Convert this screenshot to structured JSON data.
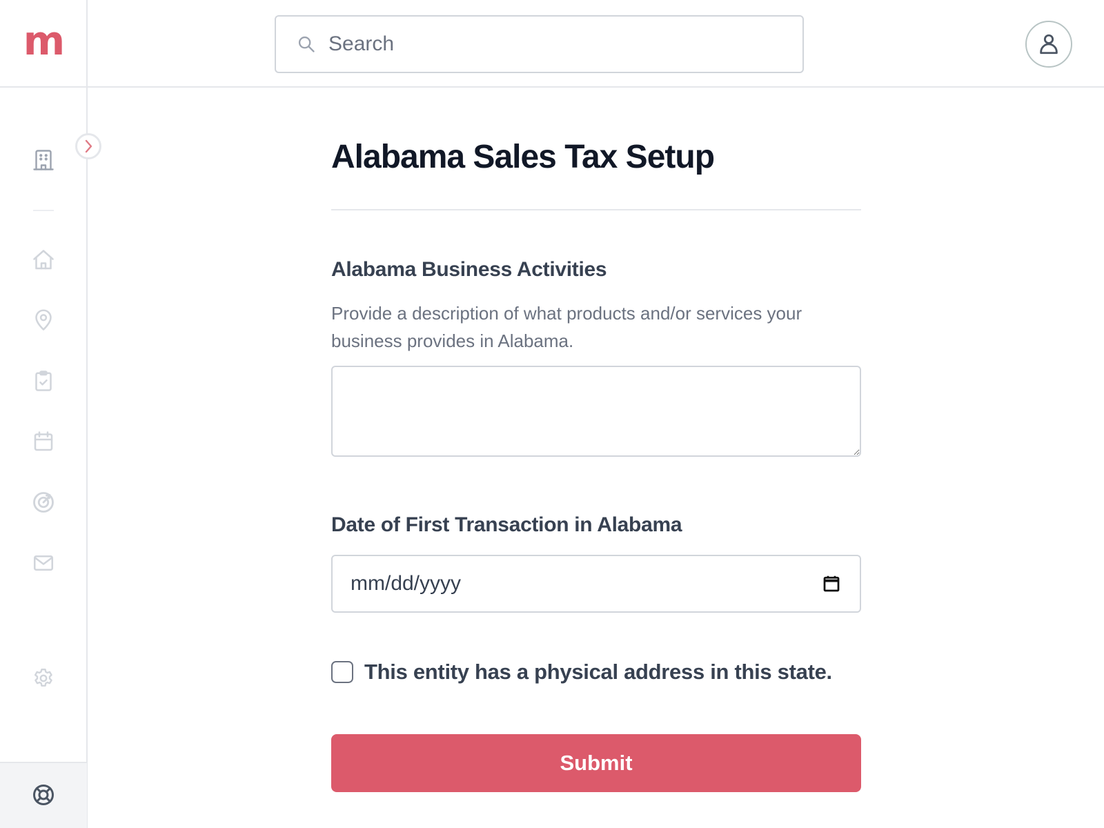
{
  "app": {
    "logo_text": "m",
    "brand_color": "#dc5a6b"
  },
  "header": {
    "search": {
      "placeholder": "Search",
      "value": "",
      "icon": "search-icon"
    },
    "account_icon": "user-icon"
  },
  "sidebar": {
    "collapse_icon": "chevron-right-icon",
    "items": [
      {
        "name": "entity",
        "icon": "building-icon"
      },
      {
        "name": "home",
        "icon": "home-icon"
      },
      {
        "name": "locations",
        "icon": "map-pin-icon"
      },
      {
        "name": "tasks",
        "icon": "clipboard-check-icon"
      },
      {
        "name": "calendar",
        "icon": "calendar-icon"
      },
      {
        "name": "reports",
        "icon": "target-icon"
      },
      {
        "name": "messages",
        "icon": "mail-icon"
      },
      {
        "name": "settings",
        "icon": "gear-icon"
      }
    ],
    "help_icon": "lifebuoy-icon"
  },
  "form": {
    "title": "Alabama Sales Tax Setup",
    "business_activities": {
      "label": "Alabama Business Activities",
      "help_text": "Provide a description of what products and/or services your business provides in Alabama.",
      "value": ""
    },
    "first_transaction_date": {
      "label": "Date of First Transaction in Alabama",
      "placeholder": "mm/dd/yyyy",
      "value": "",
      "icon": "calendar-icon"
    },
    "physical_address": {
      "label": "This entity has a physical address in this state.",
      "checked": false
    },
    "submit_label": "Submit"
  }
}
